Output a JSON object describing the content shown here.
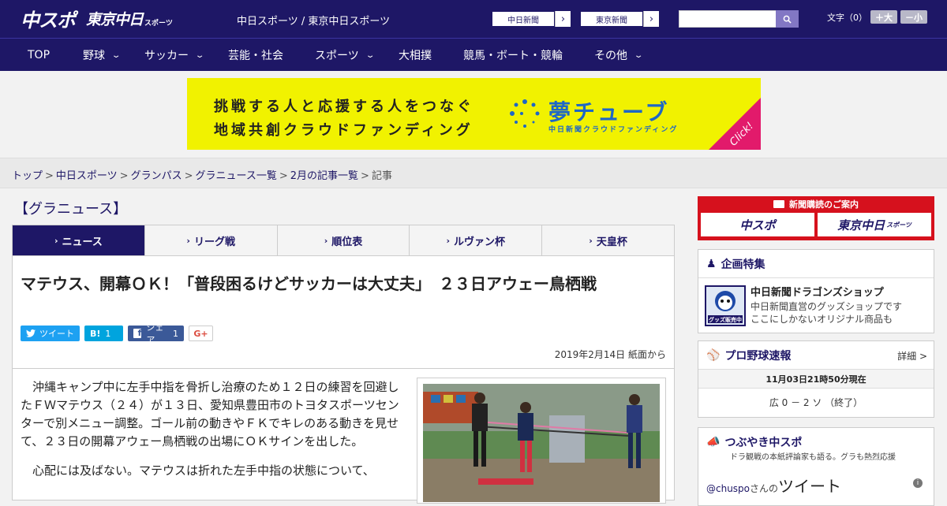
{
  "header": {
    "logo_main": "中スポ",
    "logo_tokyo": "東京中日",
    "logo_sports": "スポーツ",
    "site_name": "中日スポーツ / 東京中日スポーツ",
    "paper_links": [
      {
        "label": "中日新聞",
        "arrow": "›"
      },
      {
        "label": "東京新聞",
        "arrow": "›"
      }
    ],
    "search_placeholder": "",
    "font_label": "文字（0）",
    "font_larger": "＋大",
    "font_smaller": "－小"
  },
  "nav": {
    "items": [
      {
        "label": "TOP",
        "dropdown": false
      },
      {
        "label": "野球",
        "dropdown": true
      },
      {
        "label": "サッカー",
        "dropdown": true
      },
      {
        "label": "芸能・社会",
        "dropdown": false
      },
      {
        "label": "スポーツ",
        "dropdown": true
      },
      {
        "label": "大相撲",
        "dropdown": false
      },
      {
        "label": "競馬・ボート・競輪",
        "dropdown": false
      },
      {
        "label": "その他",
        "dropdown": true
      }
    ]
  },
  "ad": {
    "line1": "挑戦する人と応援する人をつなぐ",
    "line2": "地域共創クラウドファンディング",
    "brand": "夢チューブ",
    "brand_sub": "中日新聞クラウドファンディング",
    "click": "Click!",
    "colors": {
      "background": "#f1f200",
      "accent": "#e21a6b",
      "brand": "#1e67c6"
    }
  },
  "breadcrumb": [
    {
      "label": "トップ",
      "link": true
    },
    {
      "label": "中日スポーツ",
      "link": true
    },
    {
      "label": "グランパス",
      "link": true
    },
    {
      "label": "グラニュース一覧",
      "link": true
    },
    {
      "label": "2月の記事一覧",
      "link": true
    },
    {
      "label": "記事",
      "link": false
    }
  ],
  "breadcrumb_sep": ">",
  "category_title": "【グラニュース】",
  "tabs": [
    {
      "label": "ニュース",
      "active": true
    },
    {
      "label": "リーグ戦",
      "active": false
    },
    {
      "label": "順位表",
      "active": false
    },
    {
      "label": "ルヴァン杯",
      "active": false
    },
    {
      "label": "天皇杯",
      "active": false
    }
  ],
  "tab_arrow": "›",
  "article": {
    "headline": "マテウス、開幕ＯＫ！「普段困るけどサッカーは大丈夫」　２３日アウェー鳥栖戦",
    "share": {
      "tweet": "ツイート",
      "hatena": "B!",
      "hatena_count": "1",
      "facebook": "シェア",
      "facebook_count": "1",
      "gplus": "G+"
    },
    "date": "2019年2月14日 紙面から",
    "paragraphs": [
      "沖縄キャンプ中に左手中指を骨折し治療のため１２日の練習を回避したＦＷマテウス（２４）が１３日、愛知県豊田市のトヨタスポーツセンターで別メニュー調整。ゴール前の動きやＦＫでキレのある動きを見せて、２３日の開幕アウェー鳥栖戦の出場にＯＫサインを出した。",
      "心配には及ばない。マテウスは折れた左手中指の状態について、"
    ]
  },
  "sidebar": {
    "subscribe": {
      "title": "新聞購読のご案内",
      "logo_chuspo": "中スポ",
      "logo_tokyo": "東京中日",
      "logo_tokyo_suffix": "スポーツ"
    },
    "feature": {
      "title": "企画特集",
      "shop_title": "中日新聞ドラゴンズショップ",
      "shop_desc_1": "中日新聞直営のグッズショップです",
      "shop_desc_2": "ここにしかないオリジナル商品も",
      "shop_badge": "グッズ販売中"
    },
    "baseball": {
      "title": "プロ野球速報",
      "more": "詳細 >",
      "time": "11月03日21時50分現在",
      "score": "広 0 － 2 ソ （終了）"
    },
    "tweets": {
      "title": "つぶやき中スポ",
      "subtitle": "ドラ観戦の本紙評論家も語る。グラも熱烈応援",
      "handle": "@chuspo",
      "handle_suffix": "さんの",
      "heading": "ツイート",
      "info": "i"
    }
  },
  "colors": {
    "navy": "#1e1766",
    "red": "#d6111d",
    "twitter": "#1da1f2",
    "hatena": "#00a4de",
    "facebook": "#3b5998"
  }
}
